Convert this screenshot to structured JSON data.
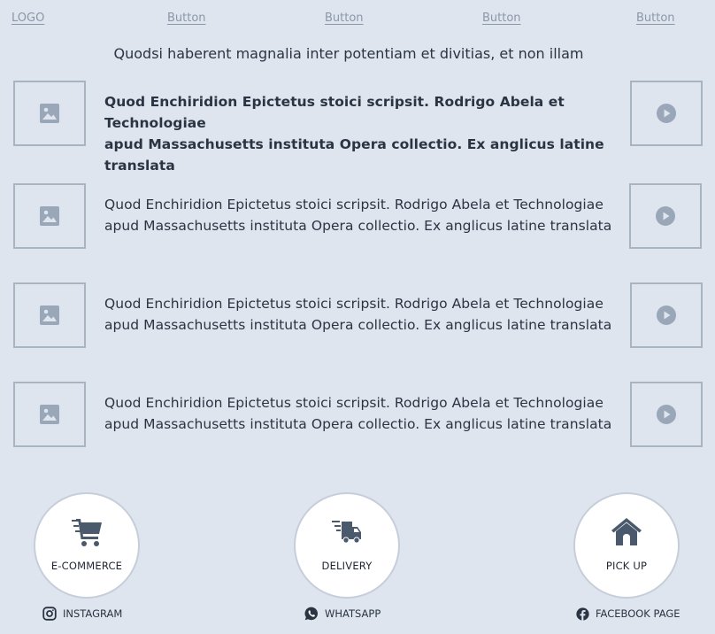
{
  "header": {
    "logo": "LOGO",
    "buttons": [
      "Button",
      "Button",
      "Button",
      "Button"
    ]
  },
  "subtitle": "Quodsi haberent magnalia inter potentiam et divitias, et non illam",
  "rows": [
    {
      "line1": "Quod Enchiridion Epictetus stoici scripsit. Rodrigo Abela et Technologiae",
      "line2": "apud Massachusetts instituta Opera collectio. Ex anglicus latine translata"
    },
    {
      "line1": "Quod Enchiridion Epictetus stoici scripsit. Rodrigo Abela et Technologiae",
      "line2": "apud Massachusetts instituta Opera collectio. Ex anglicus latine translata"
    },
    {
      "line1": "Quod Enchiridion Epictetus stoici scripsit. Rodrigo Abela et Technologiae",
      "line2": "apud Massachusetts instituta Opera collectio. Ex anglicus latine translata"
    },
    {
      "line1": "Quod Enchiridion Epictetus stoici scripsit. Rodrigo Abela et Technologiae",
      "line2": "apud Massachusetts instituta Opera collectio. Ex anglicus latine translata"
    }
  ],
  "services": [
    {
      "label": "E-COMMERCE",
      "icon": "cart-icon"
    },
    {
      "label": "DELIVERY",
      "icon": "delivery-truck-icon"
    },
    {
      "label": "PICK UP",
      "icon": "home-icon"
    }
  ],
  "social": [
    {
      "label": "INSTAGRAM",
      "icon": "instagram-icon"
    },
    {
      "label": "WHATSAPP",
      "icon": "whatsapp-icon"
    },
    {
      "label": "FACEBOOK PAGE",
      "icon": "facebook-icon"
    }
  ],
  "colors": {
    "background": "#dfe5ee",
    "placeholder_border": "#a9b4c2",
    "placeholder_icon": "#9aa7b8",
    "icon_dark": "#4a5a6c",
    "text": "#2a3442"
  }
}
